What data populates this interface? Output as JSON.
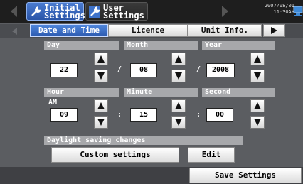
{
  "header": {
    "initial_settings": "Initial\nSettings",
    "user_settings": "User\nSettings",
    "date": "2007/08/01",
    "time": "11:30AM"
  },
  "tabs": [
    {
      "label": "Date and Time",
      "active": true
    },
    {
      "label": "Licence",
      "active": false
    },
    {
      "label": "Unit Info.",
      "active": false
    }
  ],
  "date": {
    "day_label": "Day",
    "month_label": "Month",
    "year_label": "Year",
    "day": "22",
    "month": "08",
    "year": "2008",
    "separator": "/"
  },
  "time": {
    "hour_label": "Hour",
    "minute_label": "Minute",
    "second_label": "Second",
    "period": "AM",
    "hour": "09",
    "minute": "15",
    "second": "00",
    "separator": ":"
  },
  "dst": {
    "label": "Daylight saving changes",
    "custom_button": "Custom settings",
    "edit_button": "Edit"
  },
  "footer": {
    "save_button": "Save Settings"
  },
  "colors": {
    "accent": "#2d5bb0",
    "panel": "#5b5d61",
    "label_bg": "#a7a8ab"
  }
}
